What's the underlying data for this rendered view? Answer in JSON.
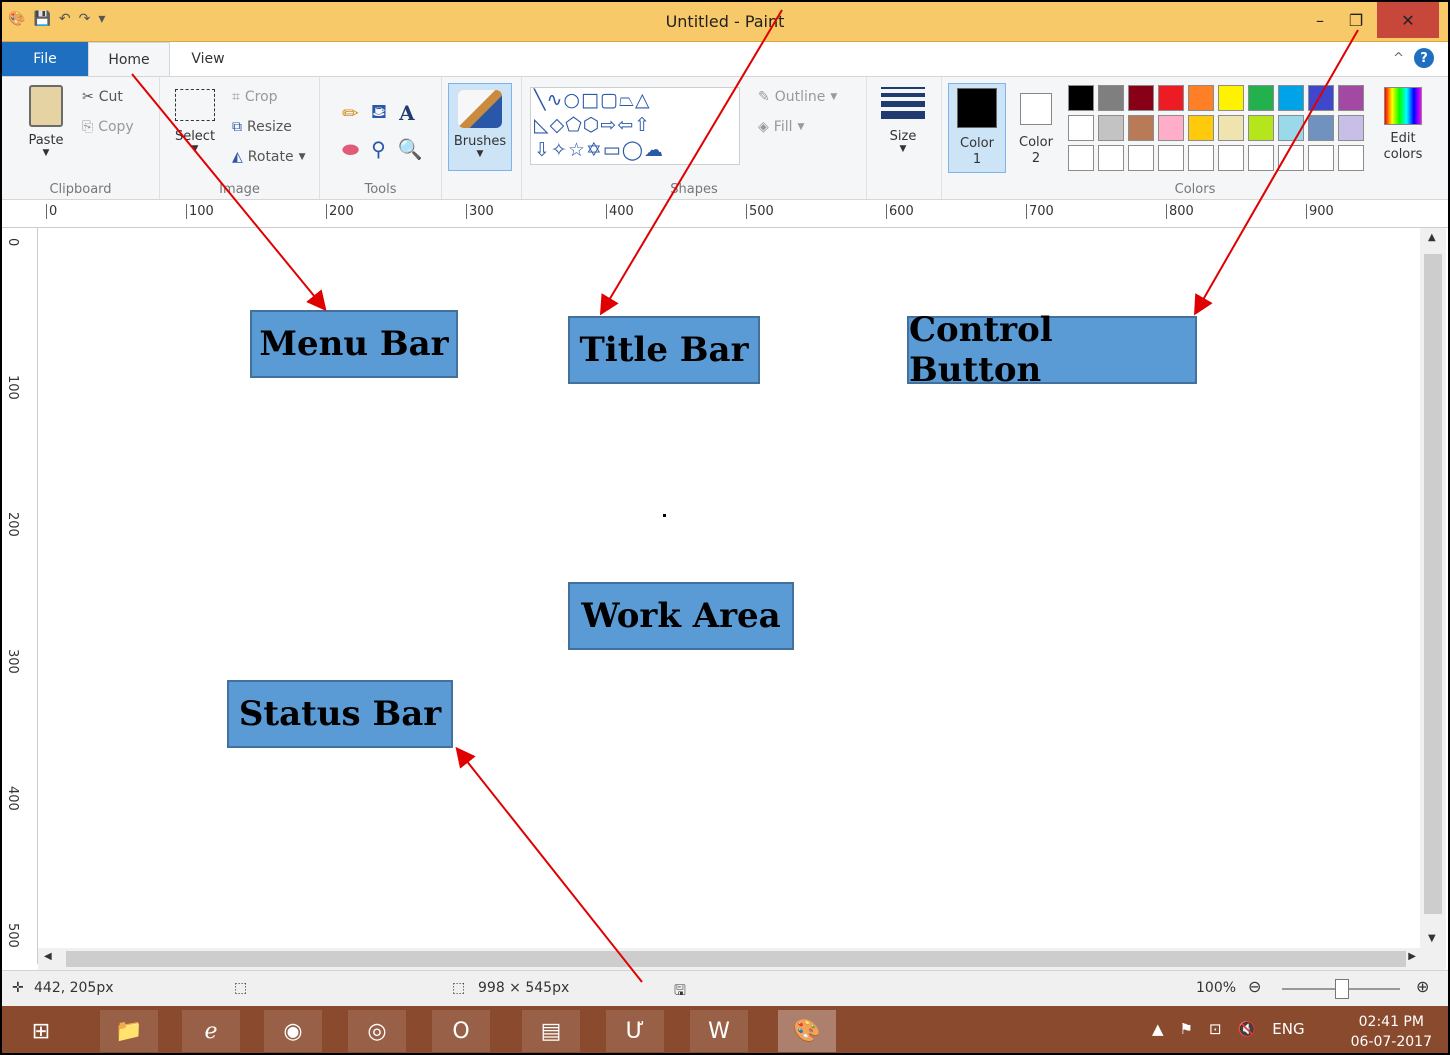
{
  "window": {
    "title": "Untitled - Paint",
    "min": "–",
    "max": "❐",
    "close": "✕"
  },
  "tabs": [
    "File",
    "Home",
    "View"
  ],
  "ribbon": {
    "clipboard": {
      "paste": "Paste",
      "cut": "Cut",
      "copy": "Copy",
      "label": "Clipboard"
    },
    "image": {
      "select": "Select",
      "crop": "Crop",
      "resize": "Resize",
      "rotate": "Rotate",
      "label": "Image"
    },
    "tools": {
      "label": "Tools"
    },
    "brushes": "Brushes",
    "shapes": {
      "outline": "Outline",
      "fill": "Fill",
      "label": "Shapes"
    },
    "size": "Size",
    "color1": "Color 1",
    "color2": "Color 2",
    "colors_label": "Colors",
    "edit_colors": "Edit colors",
    "palette_row1": [
      "#000000",
      "#7f7f7f",
      "#880015",
      "#ed1c24",
      "#ff7f27",
      "#fff200",
      "#22b14c",
      "#00a2e8",
      "#3f48cc",
      "#a349a4"
    ],
    "palette_row2": [
      "#ffffff",
      "#c3c3c3",
      "#b97a57",
      "#ffaec9",
      "#ffc90e",
      "#efe4b0",
      "#b5e61d",
      "#99d9ea",
      "#7092be",
      "#c8bfe7"
    ]
  },
  "ruler": {
    "top": [
      "0",
      "100",
      "200",
      "300",
      "400",
      "500",
      "600",
      "700",
      "800",
      "900"
    ],
    "left": [
      "0",
      "100",
      "200",
      "300",
      "400",
      "500"
    ]
  },
  "status": {
    "cursor": "442, 205px",
    "size": "998 × 545px",
    "zoom": "100%"
  },
  "taskbar": {
    "tray_lang": "ENG",
    "time": "02:41 PM",
    "date": "06-07-2017"
  },
  "annotations": {
    "menu_bar": "Menu Bar",
    "title_bar": "Title Bar",
    "control_button": "Control Button",
    "work_area": "Work Area",
    "status_bar": "Status Bar"
  }
}
